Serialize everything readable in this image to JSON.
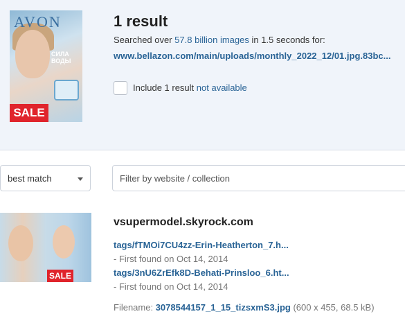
{
  "summary": {
    "title": "1 result",
    "searched_prefix": "Searched over ",
    "searched_count": "57.8 billion images",
    "searched_suffix": " in 1.5 seconds for:",
    "query_url": "www.bellazon.com/main/uploads/monthly_2022_12/01.jpg.83bc...",
    "include_prefix": "Include 1 result ",
    "include_link": "not available",
    "sale_badge": "SALE",
    "thumb_logo": "AVON",
    "thumb_text": "СИЛА ВОДЫ"
  },
  "controls": {
    "sort_value": "best match",
    "filter_placeholder": "Filter by website / collection"
  },
  "results": [
    {
      "domain": "vsupermodel.skyrock.com",
      "sale_badge": "SALE",
      "matches": [
        {
          "path": "tags/fTMOi7CU4zz-Erin-Heatherton_7.h...",
          "found": "- First found on Oct 14, 2014"
        },
        {
          "path": "tags/3nU6ZrEfk8D-Behati-Prinsloo_6.ht...",
          "found": "- First found on Oct 14, 2014"
        }
      ],
      "filename_label": "Filename: ",
      "filename": "3078544157_1_15_tizsxmS3.jpg",
      "filename_meta": " (600 x 455, 68.5 kB)"
    }
  ]
}
